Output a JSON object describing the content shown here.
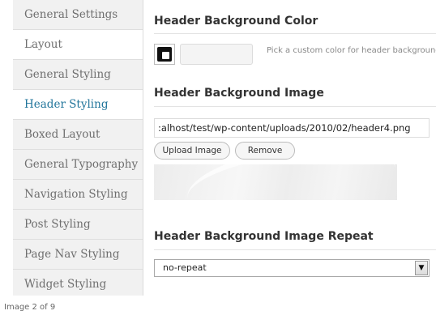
{
  "sidebar": {
    "items": [
      {
        "label": "General Settings"
      },
      {
        "label": "Layout"
      },
      {
        "label": "General Styling"
      },
      {
        "label": "Header Styling"
      },
      {
        "label": "Boxed Layout"
      },
      {
        "label": "General Typography"
      },
      {
        "label": "Navigation Styling"
      },
      {
        "label": "Post Styling"
      },
      {
        "label": "Page Nav Styling"
      },
      {
        "label": "Widget Styling"
      }
    ]
  },
  "header_bg_color": {
    "title": "Header Background Color",
    "value": "",
    "hint": "Pick a custom color for header background",
    "swatch_color": "#111111"
  },
  "header_bg_image": {
    "title": "Header Background Image",
    "url_value": ":alhost/test/wp-content/uploads/2010/02/header4.png",
    "upload_label": "Upload Image",
    "remove_label": "Remove"
  },
  "header_bg_repeat": {
    "title": "Header Background Image Repeat",
    "selected": "no-repeat"
  },
  "caption": "Image 2 of 9",
  "colors": {
    "accent": "#21759b",
    "sidebar_bg": "#f1f1f1"
  }
}
